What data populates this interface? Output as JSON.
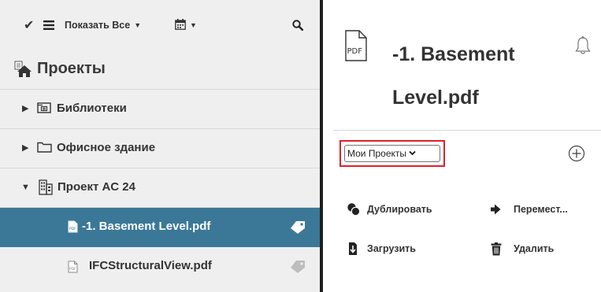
{
  "toolbar": {
    "check_icon": "checkmark-icon",
    "list_icon": "hamburger-icon",
    "filter_label": "Показать Все",
    "calendar_icon": "calendar-icon",
    "search_icon": "search-icon"
  },
  "projects": {
    "title": "Проекты",
    "icon": "projects-house-icon"
  },
  "tree": {
    "items": [
      {
        "label": "Библиотеки",
        "icon": "library-folder-icon",
        "expanded": false
      },
      {
        "label": "Офисное здание",
        "icon": "folder-icon",
        "expanded": false
      },
      {
        "label": "Проект AC 24",
        "icon": "building-icon",
        "expanded": true
      },
      {
        "label": "-1. Basement Level.pdf",
        "icon": "pdf-file-icon",
        "selected": true,
        "tag_icon": "tag-icon"
      },
      {
        "label": "IFCStructuralView.pdf",
        "icon": "pdf-file-icon",
        "selected": false,
        "tag_icon": "tag-icon"
      }
    ]
  },
  "detail": {
    "file_icon": "pdf-file-icon",
    "pdf_badge": "PDF",
    "title_line1": "-1. Basement",
    "title_line2": "Level.pdf",
    "bell_icon": "bell-icon",
    "project_select": {
      "value": "Мои Проекты"
    },
    "add_icon": "plus-circle-icon",
    "actions": {
      "duplicate": "Дублировать",
      "move": "Перемест...",
      "download": "Загрузить",
      "delete": "Удалить"
    }
  },
  "colors": {
    "selected_row": "#3b7897",
    "highlight_border": "#e0202a",
    "left_bg": "#efefef"
  }
}
